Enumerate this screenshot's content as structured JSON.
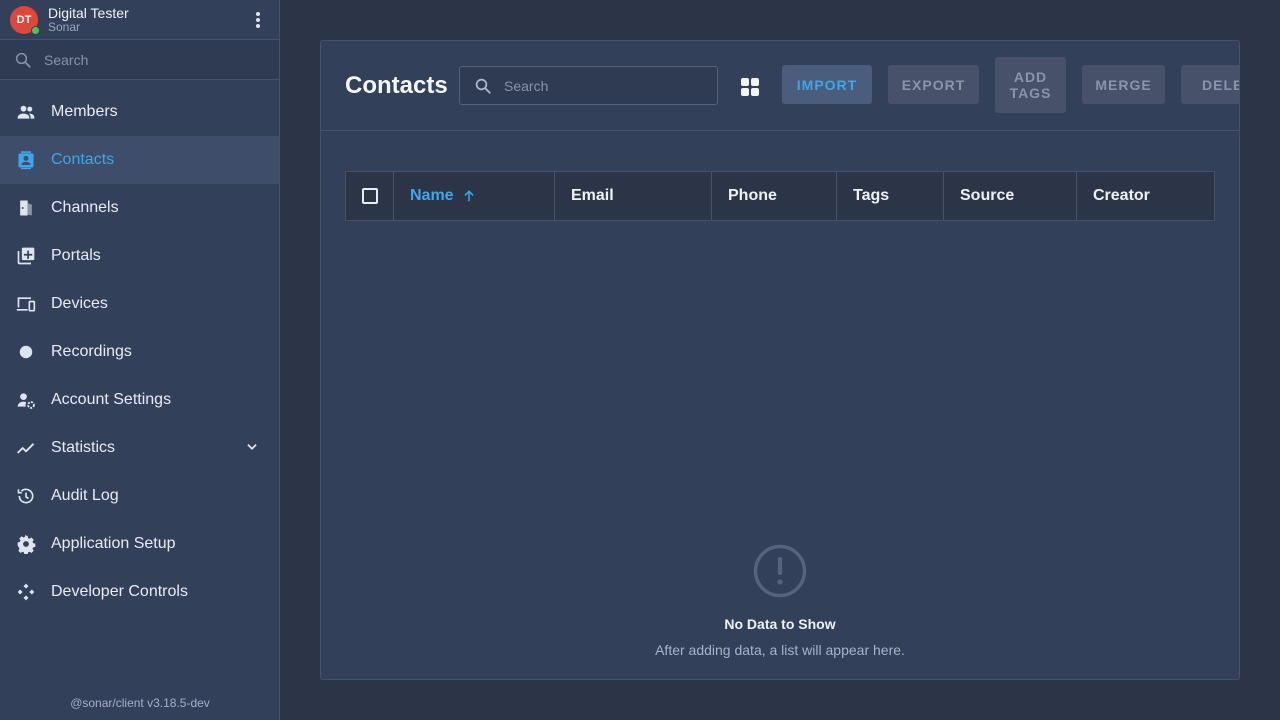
{
  "user": {
    "initials": "DT",
    "name": "Digital Tester",
    "org": "Sonar"
  },
  "sidebar": {
    "search_placeholder": "Search",
    "items": [
      {
        "label": "Members",
        "icon": "members-icon"
      },
      {
        "label": "Contacts",
        "icon": "contacts-icon",
        "active": true
      },
      {
        "label": "Channels",
        "icon": "channels-icon"
      },
      {
        "label": "Portals",
        "icon": "portals-icon"
      },
      {
        "label": "Devices",
        "icon": "devices-icon"
      },
      {
        "label": "Recordings",
        "icon": "recordings-icon"
      },
      {
        "label": "Account Settings",
        "icon": "account-settings-icon"
      },
      {
        "label": "Statistics",
        "icon": "statistics-icon",
        "expandable": true
      },
      {
        "label": "Audit Log",
        "icon": "audit-log-icon"
      },
      {
        "label": "Application Setup",
        "icon": "gear-icon"
      },
      {
        "label": "Developer Controls",
        "icon": "developer-controls-icon"
      }
    ],
    "version": "@sonar/client v3.18.5-dev"
  },
  "main": {
    "title": "Contacts",
    "search_placeholder": "Search",
    "buttons": {
      "import": "IMPORT",
      "export": "EXPORT",
      "add_tags": "ADD TAGS",
      "merge": "MERGE",
      "delete": "DELETE"
    },
    "columns": [
      "Name",
      "Email",
      "Phone",
      "Tags",
      "Source",
      "Creator"
    ],
    "sort": {
      "column": "Name",
      "direction": "ascending"
    },
    "empty": {
      "title": "No Data to Show",
      "subtitle": "After adding data, a list will appear here."
    }
  },
  "colors": {
    "accent": "#3ea6ea",
    "background": "#2b3547",
    "panel": "#33405a",
    "avatar": "#e0463a",
    "online": "#4cc35a"
  }
}
